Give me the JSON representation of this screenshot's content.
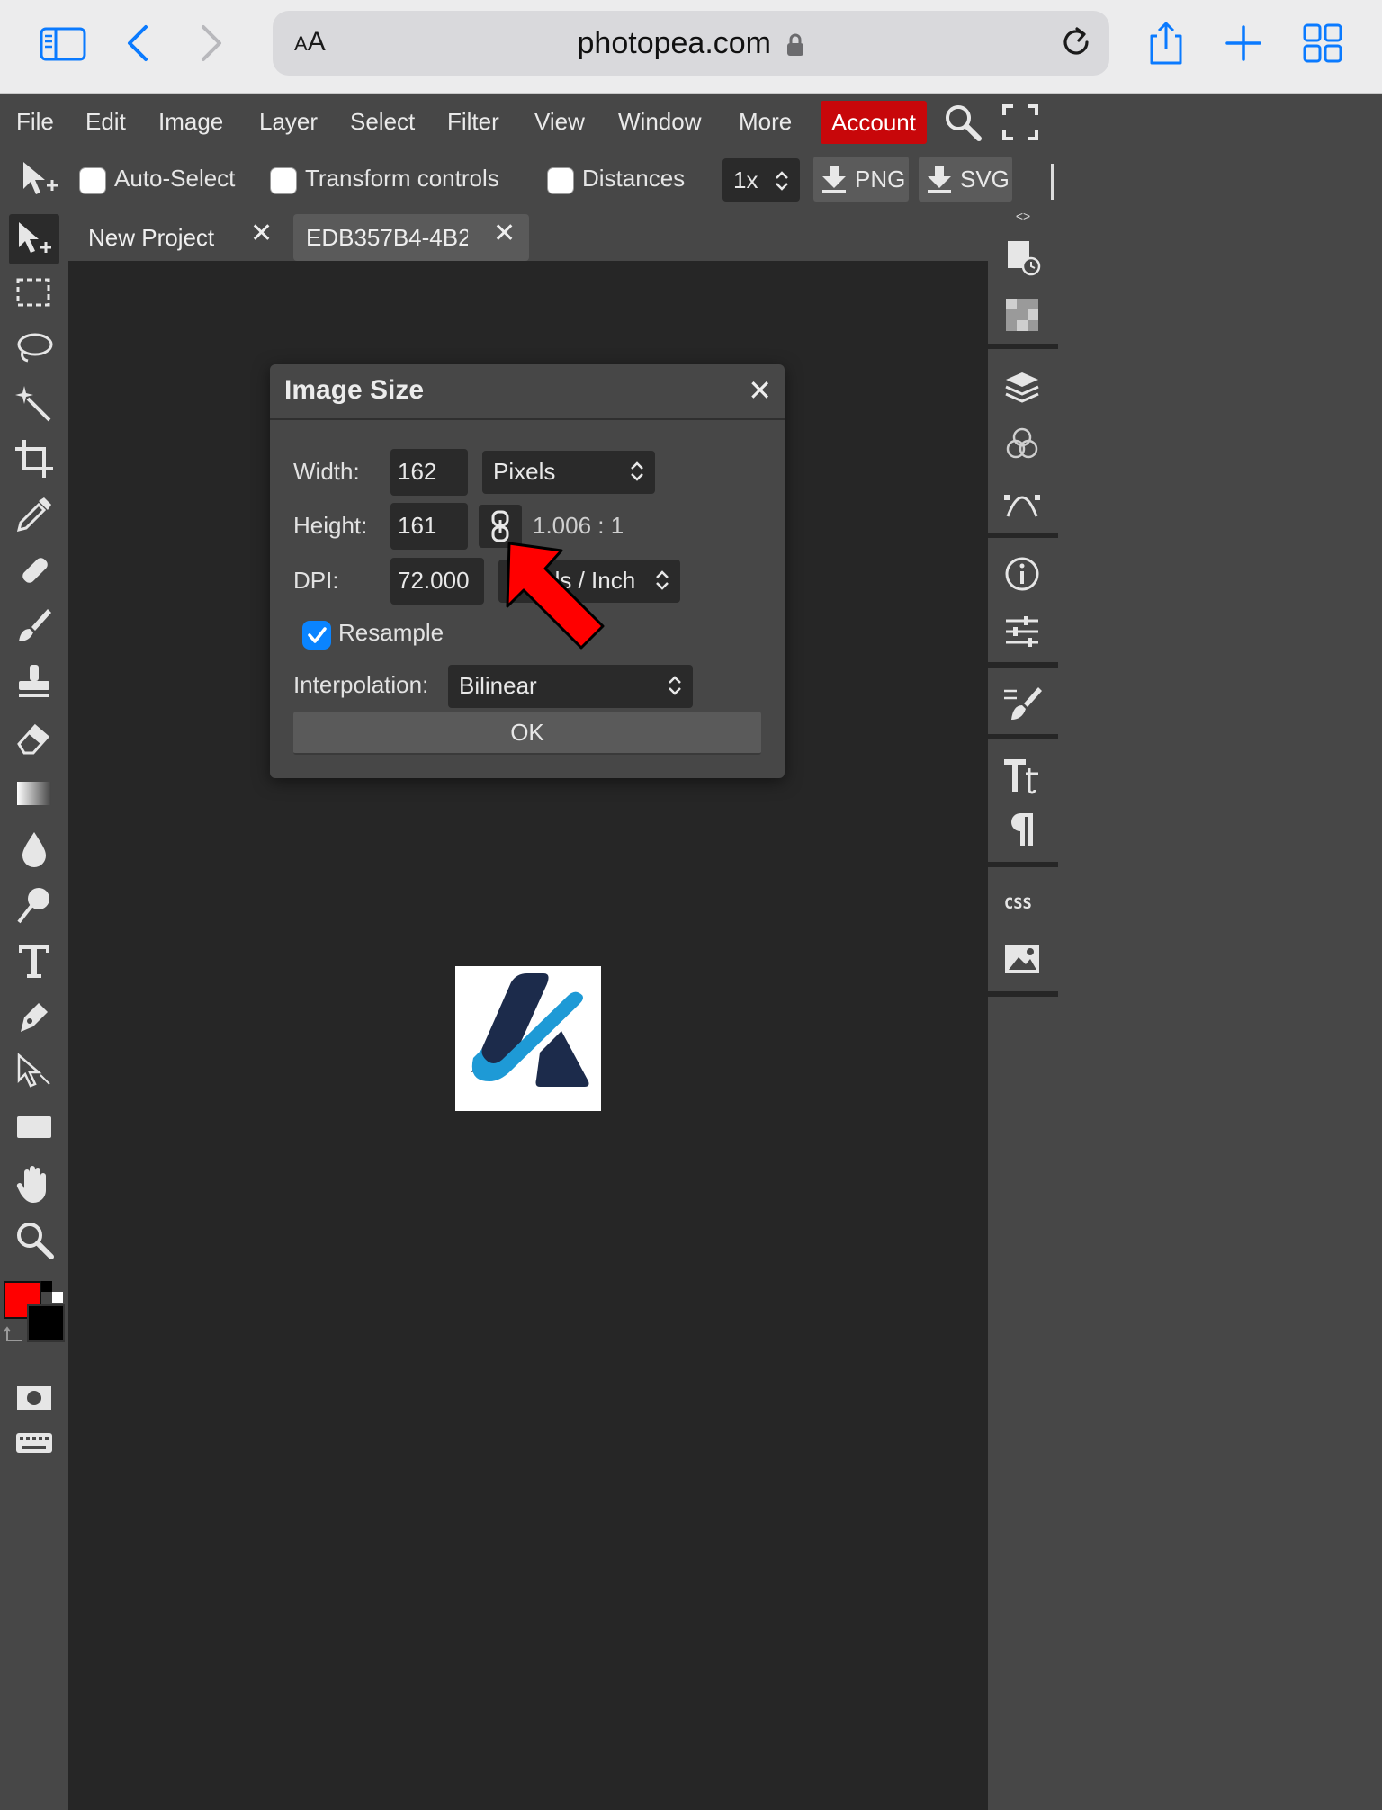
{
  "browser": {
    "aa_label_small": "A",
    "aa_label_large": "A",
    "url": "photopea.com"
  },
  "menu": {
    "items": [
      "File",
      "Edit",
      "Image",
      "Layer",
      "Select",
      "Filter",
      "View",
      "Window",
      "More"
    ],
    "account": "Account"
  },
  "options": {
    "auto_select": "Auto-Select",
    "transform_controls": "Transform controls",
    "distances": "Distances",
    "zoom": "1x",
    "png": "PNG",
    "svg": "SVG"
  },
  "tabs": [
    {
      "label": "New Project"
    },
    {
      "label": "EDB357B4-4B2"
    }
  ],
  "panel_toggle": "<>",
  "dialog": {
    "title": "Image Size",
    "width_label": "Width:",
    "width_value": "162",
    "width_unit": "Pixels",
    "height_label": "Height:",
    "height_value": "161",
    "ratio": "1.006 : 1",
    "dpi_label": "DPI:",
    "dpi_value": "72.000",
    "dpi_unit": "Pixels / Inch",
    "resample": "Resample",
    "resample_checked": true,
    "interp_label": "Interpolation:",
    "interp_value": "Bilinear",
    "ok": "OK"
  },
  "colors": {
    "foreground": "#ff0000",
    "background": "#000000",
    "account_bg": "#c8070a",
    "accent": "#0a84ff"
  }
}
